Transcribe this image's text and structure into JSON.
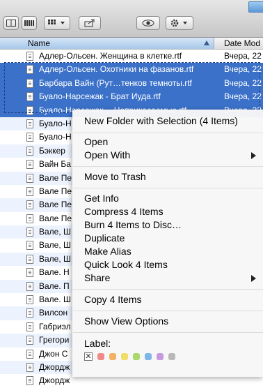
{
  "columns": {
    "name": "Name",
    "date": "Date Mod"
  },
  "files": [
    {
      "name": "Адлер-Ольсен. Женщина в клетке.rtf",
      "date": "Вчера, 22",
      "selected": false
    },
    {
      "name": "Адлер-Ольсен. Охотники на фазанов.rtf",
      "date": "Вчера, 22",
      "selected": true
    },
    {
      "name": "Барбара Вайн (Рут…тенков темноты.rtf",
      "date": "Вчера, 22",
      "selected": true
    },
    {
      "name": "Буало-Нарсежак - Брат Иуда.rtf",
      "date": "Вчера, 22",
      "selected": true
    },
    {
      "name": "Буало-Нарсежак… Неприкасаемые.rtf",
      "date": "Вчера, 22",
      "selected": true
    },
    {
      "name": "Буало-Н",
      "date": "",
      "selected": false
    },
    {
      "name": "Буало-Н",
      "date": "",
      "selected": false
    },
    {
      "name": "Бэккер",
      "date": "",
      "selected": false
    },
    {
      "name": "Вайн Ба",
      "date": "",
      "selected": false
    },
    {
      "name": "Вале Пе",
      "date": "",
      "selected": false
    },
    {
      "name": "Вале Пе",
      "date": "",
      "selected": false
    },
    {
      "name": "Вале Пе",
      "date": "",
      "selected": false
    },
    {
      "name": "Вале Пе",
      "date": "",
      "selected": false
    },
    {
      "name": "Вале, Ш",
      "date": "",
      "selected": false
    },
    {
      "name": "Вале, Ш",
      "date": "",
      "selected": false
    },
    {
      "name": "Вале, Ш",
      "date": "",
      "selected": false
    },
    {
      "name": "Вале. Н",
      "date": "",
      "selected": false
    },
    {
      "name": "Вале. П",
      "date": "",
      "selected": false
    },
    {
      "name": "Вале. Ш",
      "date": "",
      "selected": false
    },
    {
      "name": "Вилсон",
      "date": "",
      "selected": false
    },
    {
      "name": "Габриэл",
      "date": "",
      "selected": false
    },
    {
      "name": "Грегори",
      "date": "",
      "selected": false
    },
    {
      "name": "Джон С",
      "date": "",
      "selected": false
    },
    {
      "name": "Джордж",
      "date": "",
      "selected": false
    },
    {
      "name": "Джордж",
      "date": "",
      "selected": false
    }
  ],
  "menu": {
    "new_folder": "New Folder with Selection (4 Items)",
    "open": "Open",
    "open_with": "Open With",
    "move_to_trash": "Move to Trash",
    "get_info": "Get Info",
    "compress": "Compress 4 Items",
    "burn": "Burn 4 Items to Disc…",
    "duplicate": "Duplicate",
    "make_alias": "Make Alias",
    "quick_look": "Quick Look 4 Items",
    "share": "Share",
    "copy": "Copy 4 Items",
    "show_view_options": "Show View Options",
    "label": "Label:"
  },
  "label_colors": [
    "#f08a8a",
    "#f2b266",
    "#f0dd6a",
    "#a9d96b",
    "#7fb6ea",
    "#c79ae0",
    "#b9b9b9"
  ],
  "colors": {
    "selection": "#3b71c9",
    "alt_row": "#edf3fe"
  }
}
